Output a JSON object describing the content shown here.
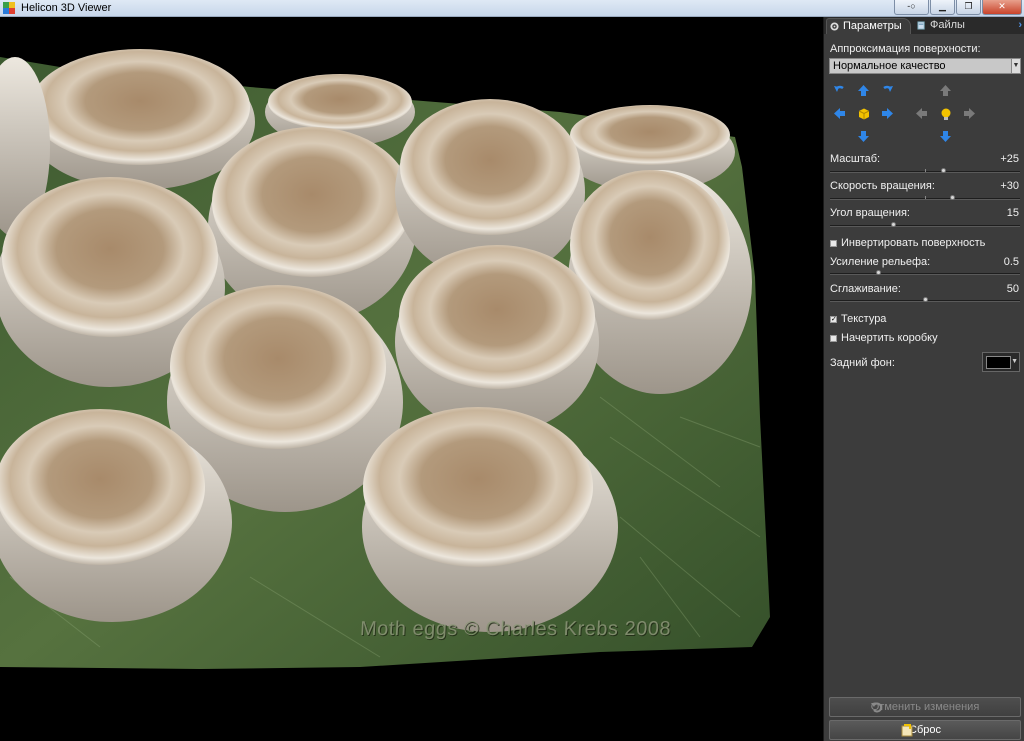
{
  "window": {
    "title": "Helicon 3D Viewer"
  },
  "tabs": [
    {
      "label": "Параметры",
      "active": true
    },
    {
      "label": "Файлы",
      "active": false
    }
  ],
  "params": {
    "surface_label": "Аппроксимация поверхности:",
    "surface_value": "Нормальное качество",
    "scale": {
      "label": "Масштаб:",
      "value": "+25",
      "level": 0.6
    },
    "rotation_speed": {
      "label": "Скорость вращения:",
      "value": "+30",
      "level": 0.65
    },
    "rotation_angle": {
      "label": "Угол вращения:",
      "value": "15",
      "level": 0.33
    },
    "invert_surface": {
      "label": "Инвертировать поверхность",
      "checked": false
    },
    "relief_gain": {
      "label": "Усиление рельефа:",
      "value": "0.5",
      "level": 0.25
    },
    "smoothing": {
      "label": "Сглаживание:",
      "value": "50",
      "level": 0.5
    },
    "texture": {
      "label": "Текстура",
      "checked": true
    },
    "draw_box": {
      "label": "Начертить коробку",
      "checked": false
    },
    "background": {
      "label": "Задний фон:",
      "color": "#000000"
    }
  },
  "buttons": {
    "cancel_changes": "Отменить изменения",
    "reset": "Сброс"
  },
  "viewport": {
    "watermark": "Moth eggs © Charles Krebs 2008"
  },
  "colors": {
    "panel_bg": "#3c3c3c",
    "arrow_blue": "#2f86e8",
    "accent_yellow": "#f2c200"
  }
}
